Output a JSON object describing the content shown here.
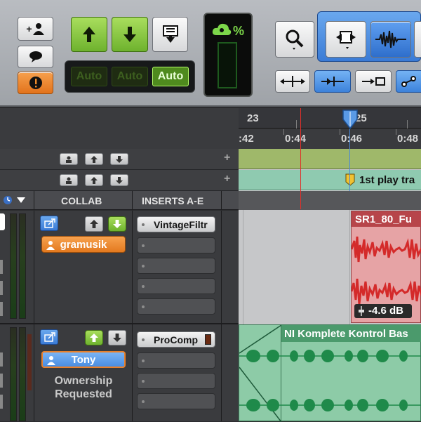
{
  "toolbar": {
    "percent_label": "%",
    "auto_buttons": [
      "Auto",
      "Auto",
      "Auto"
    ]
  },
  "ruler": {
    "bar_labels": [
      "23",
      "25"
    ],
    "time_labels": [
      ":42",
      "0:44",
      "0:46",
      "0:48"
    ]
  },
  "markers": {
    "marker_label": "1st play tra"
  },
  "columns": {
    "collab": "COLLAB",
    "inserts": "INSERTS A-E"
  },
  "tracks": [
    {
      "user": "gramusik",
      "insert": "VintageFiltr",
      "clip_name": "SR1_80_Fu",
      "clip_gain": "-4.6 dB"
    },
    {
      "user": "Tony",
      "insert": "ProComp",
      "status_line1": "Ownership",
      "status_line2": "Requested",
      "clip_name": "NI Komplete Kontrol Bas"
    }
  ],
  "colors": {
    "green": "#7bc23a",
    "orange": "#f08a2a",
    "blue": "#4f8fe0",
    "marker_track": "#8fb8a0",
    "audio_red": "#d42a2a",
    "audio_green": "#1f8a4a"
  }
}
